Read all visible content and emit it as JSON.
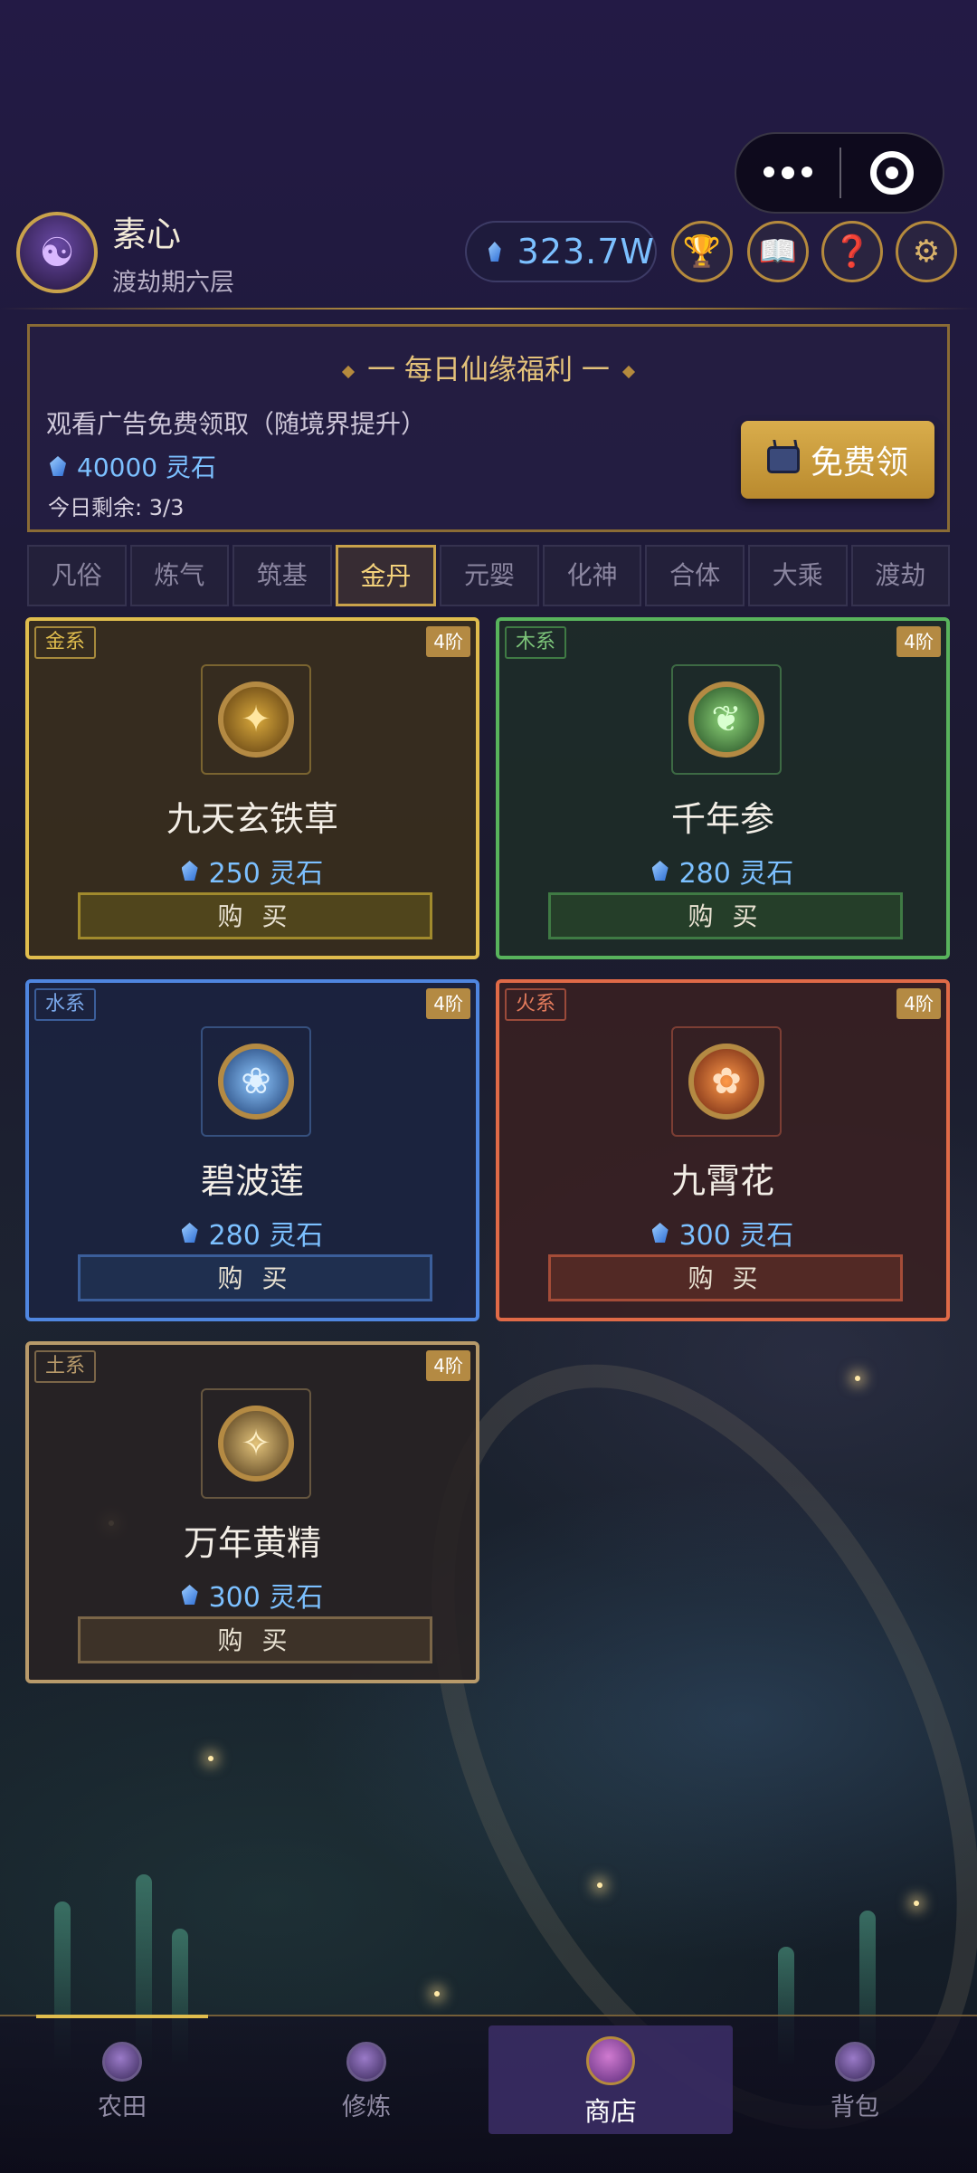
{
  "player": {
    "name": "素心",
    "rank": "渡劫期六层",
    "avatar_icon": "cultivator-avatar"
  },
  "currency": {
    "spirit_stones": "323.7W",
    "icon": "spirit-stone-gem"
  },
  "header_buttons": [
    {
      "name": "trophy",
      "glyph": "🏆"
    },
    {
      "name": "book",
      "glyph": "📖"
    },
    {
      "name": "help",
      "glyph": "❓"
    },
    {
      "name": "settings",
      "glyph": "⚙"
    }
  ],
  "daily": {
    "title": "一 每日仙缘福利 一",
    "desc": "观看广告免费领取（随境界提升）",
    "reward": "40000 灵石",
    "remain": "今日剩余: 3/3",
    "button": "免费领"
  },
  "tabs": [
    {
      "label": "凡俗",
      "active": false
    },
    {
      "label": "炼气",
      "active": false
    },
    {
      "label": "筑基",
      "active": false
    },
    {
      "label": "金丹",
      "active": true
    },
    {
      "label": "元婴",
      "active": false
    },
    {
      "label": "化神",
      "active": false
    },
    {
      "label": "合体",
      "active": false
    },
    {
      "label": "大乘",
      "active": false
    },
    {
      "label": "渡劫",
      "active": false
    }
  ],
  "items": [
    {
      "element": "金系",
      "tier": "4阶",
      "name": "九天玄铁草",
      "price": "250 灵石",
      "buy": "购 买",
      "glyph": "✦"
    },
    {
      "element": "木系",
      "tier": "4阶",
      "name": "千年参",
      "price": "280 灵石",
      "buy": "购 买",
      "glyph": "❦"
    },
    {
      "element": "水系",
      "tier": "4阶",
      "name": "碧波莲",
      "price": "280 灵石",
      "buy": "购 买",
      "glyph": "❀"
    },
    {
      "element": "火系",
      "tier": "4阶",
      "name": "九霄花",
      "price": "300 灵石",
      "buy": "购 买",
      "glyph": "✿"
    },
    {
      "element": "土系",
      "tier": "4阶",
      "name": "万年黄精",
      "price": "300 灵石",
      "buy": "购 买",
      "glyph": "✧"
    }
  ],
  "nav": [
    {
      "label": "农田",
      "active": false
    },
    {
      "label": "修炼",
      "active": false
    },
    {
      "label": "商店",
      "active": true
    },
    {
      "label": "背包",
      "active": false
    }
  ],
  "colors": {
    "accent_gold": "#c9a24b",
    "stone_blue": "#7cc0ff",
    "metal": "#e0bd4d",
    "wood": "#58b35c",
    "water": "#4f86e0",
    "fire": "#e06a47",
    "earth": "#b89a6a"
  }
}
